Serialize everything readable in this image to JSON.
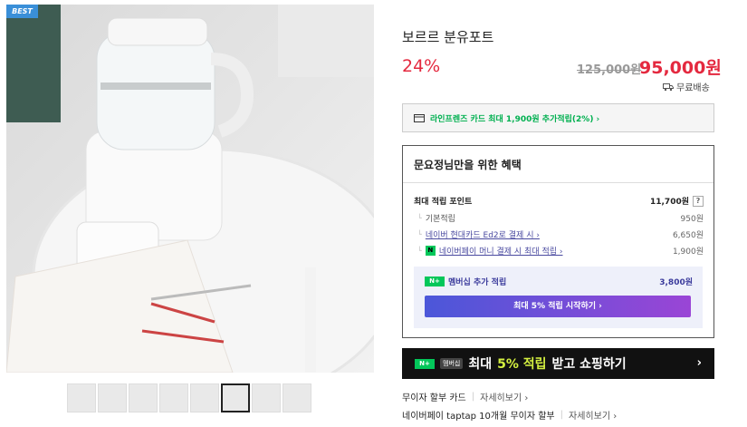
{
  "badge": "BEST",
  "product": {
    "title": "보르르 분유포트",
    "discount": "24%",
    "original_price": "125,000원",
    "sale_price": "95,000원",
    "shipping": "무료배송"
  },
  "card_promo": "라인프렌즈 카드 최대 1,900원 추가적립(2%) ›",
  "benefit": {
    "title": "문요정님만을 위한 혜택",
    "max_points_label": "최대 적립 포인트",
    "max_points_value": "11,700원",
    "help": "?",
    "rows": [
      {
        "label": "기본적립",
        "value": "950원"
      },
      {
        "label": "네이버 현대카드 Ed2로 결제 시 ›",
        "value": "6,650원"
      },
      {
        "label": "네이버페이 머니 결제 시 최대 적립 ›",
        "value": "1,900원"
      }
    ],
    "npay_icon": "N",
    "membership_badge": "N+",
    "membership_label": "멤버십 추가 적립",
    "membership_value": "3,800원",
    "start_button": "최대 5% 적립 시작하기 ›"
  },
  "banner": {
    "badge": "N+",
    "badge_text": "멤버십",
    "text_before": "최대",
    "highlight": "5% 적립",
    "text_after": "받고 쇼핑하기",
    "chevron": "›"
  },
  "installments": [
    {
      "label": "무이자 할부 카드",
      "more": "자세히보기 ›"
    },
    {
      "label": "네이버페이 taptap 10개월 무이자 할부",
      "more": "자세히보기 ›"
    }
  ],
  "colors": {
    "accent_red": "#e4293f",
    "naver_green": "#03c75a",
    "member_purple": "#3b3b9c"
  }
}
